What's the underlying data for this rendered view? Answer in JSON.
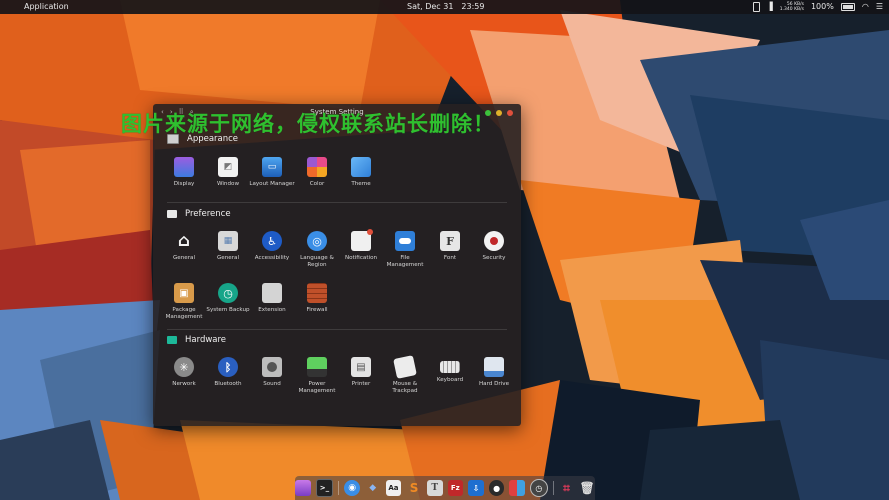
{
  "topbar": {
    "apple_glyph": "",
    "app_menu": "Application",
    "clock_day": "Sat, Dec 31",
    "clock_time": "23:59",
    "net_up": "56 KB/s",
    "net_down": "1.340 KB/s",
    "battery_percent": "100%"
  },
  "watermark": "图片来源于网络，侵权联系站长删除！",
  "window": {
    "title": "System Setting",
    "sections": [
      {
        "name": "Appearance",
        "icon": "monitor-icon",
        "items": [
          {
            "label": "Display",
            "icon": "display-icon"
          },
          {
            "label": "Window",
            "icon": "window-icon"
          },
          {
            "label": "Layout Manager",
            "icon": "layout-manager-icon"
          },
          {
            "label": "Color",
            "icon": "color-icon"
          },
          {
            "label": "Theme",
            "icon": "theme-icon"
          }
        ]
      },
      {
        "name": "Preference",
        "icon": "preference-icon",
        "items": [
          {
            "label": "General",
            "icon": "home-icon"
          },
          {
            "label": "General",
            "icon": "general-panel-icon"
          },
          {
            "label": "Accessibility",
            "icon": "accessibility-icon"
          },
          {
            "label": "Language & Region",
            "icon": "globe-icon"
          },
          {
            "label": "Notification",
            "icon": "notification-icon"
          },
          {
            "label": "File Management",
            "icon": "toggle-icon"
          },
          {
            "label": "Font",
            "icon": "font-icon"
          },
          {
            "label": "Security",
            "icon": "security-icon"
          },
          {
            "label": "Package Management",
            "icon": "package-icon"
          },
          {
            "label": "System Backup",
            "icon": "backup-icon"
          },
          {
            "label": "Extension",
            "icon": "puzzle-icon"
          },
          {
            "label": "Firewall",
            "icon": "firewall-icon"
          }
        ]
      },
      {
        "name": "Hardware",
        "icon": "hardware-icon",
        "items": [
          {
            "label": "Nerwork",
            "icon": "network-icon"
          },
          {
            "label": "Bluetooth",
            "icon": "bluetooth-icon"
          },
          {
            "label": "Sound",
            "icon": "speaker-icon"
          },
          {
            "label": "Power Management",
            "icon": "battery-icon"
          },
          {
            "label": "Printer",
            "icon": "printer-icon"
          },
          {
            "label": "Mouse & Trackpad",
            "icon": "mouse-icon"
          },
          {
            "label": "Keyboard",
            "icon": "keyboard-icon"
          },
          {
            "label": "Hard Drive",
            "icon": "hard-drive-icon"
          }
        ]
      }
    ]
  },
  "dock": {
    "font_glyph": "T",
    "text_glyph": "Aa",
    "sublime_glyph": "S",
    "filezilla_glyph": "Fz"
  },
  "colors": {
    "accent_blue": "#2f7fd8",
    "light_green": "#3cc13c",
    "light_yellow": "#e0b02a",
    "light_red": "#e0503c"
  }
}
